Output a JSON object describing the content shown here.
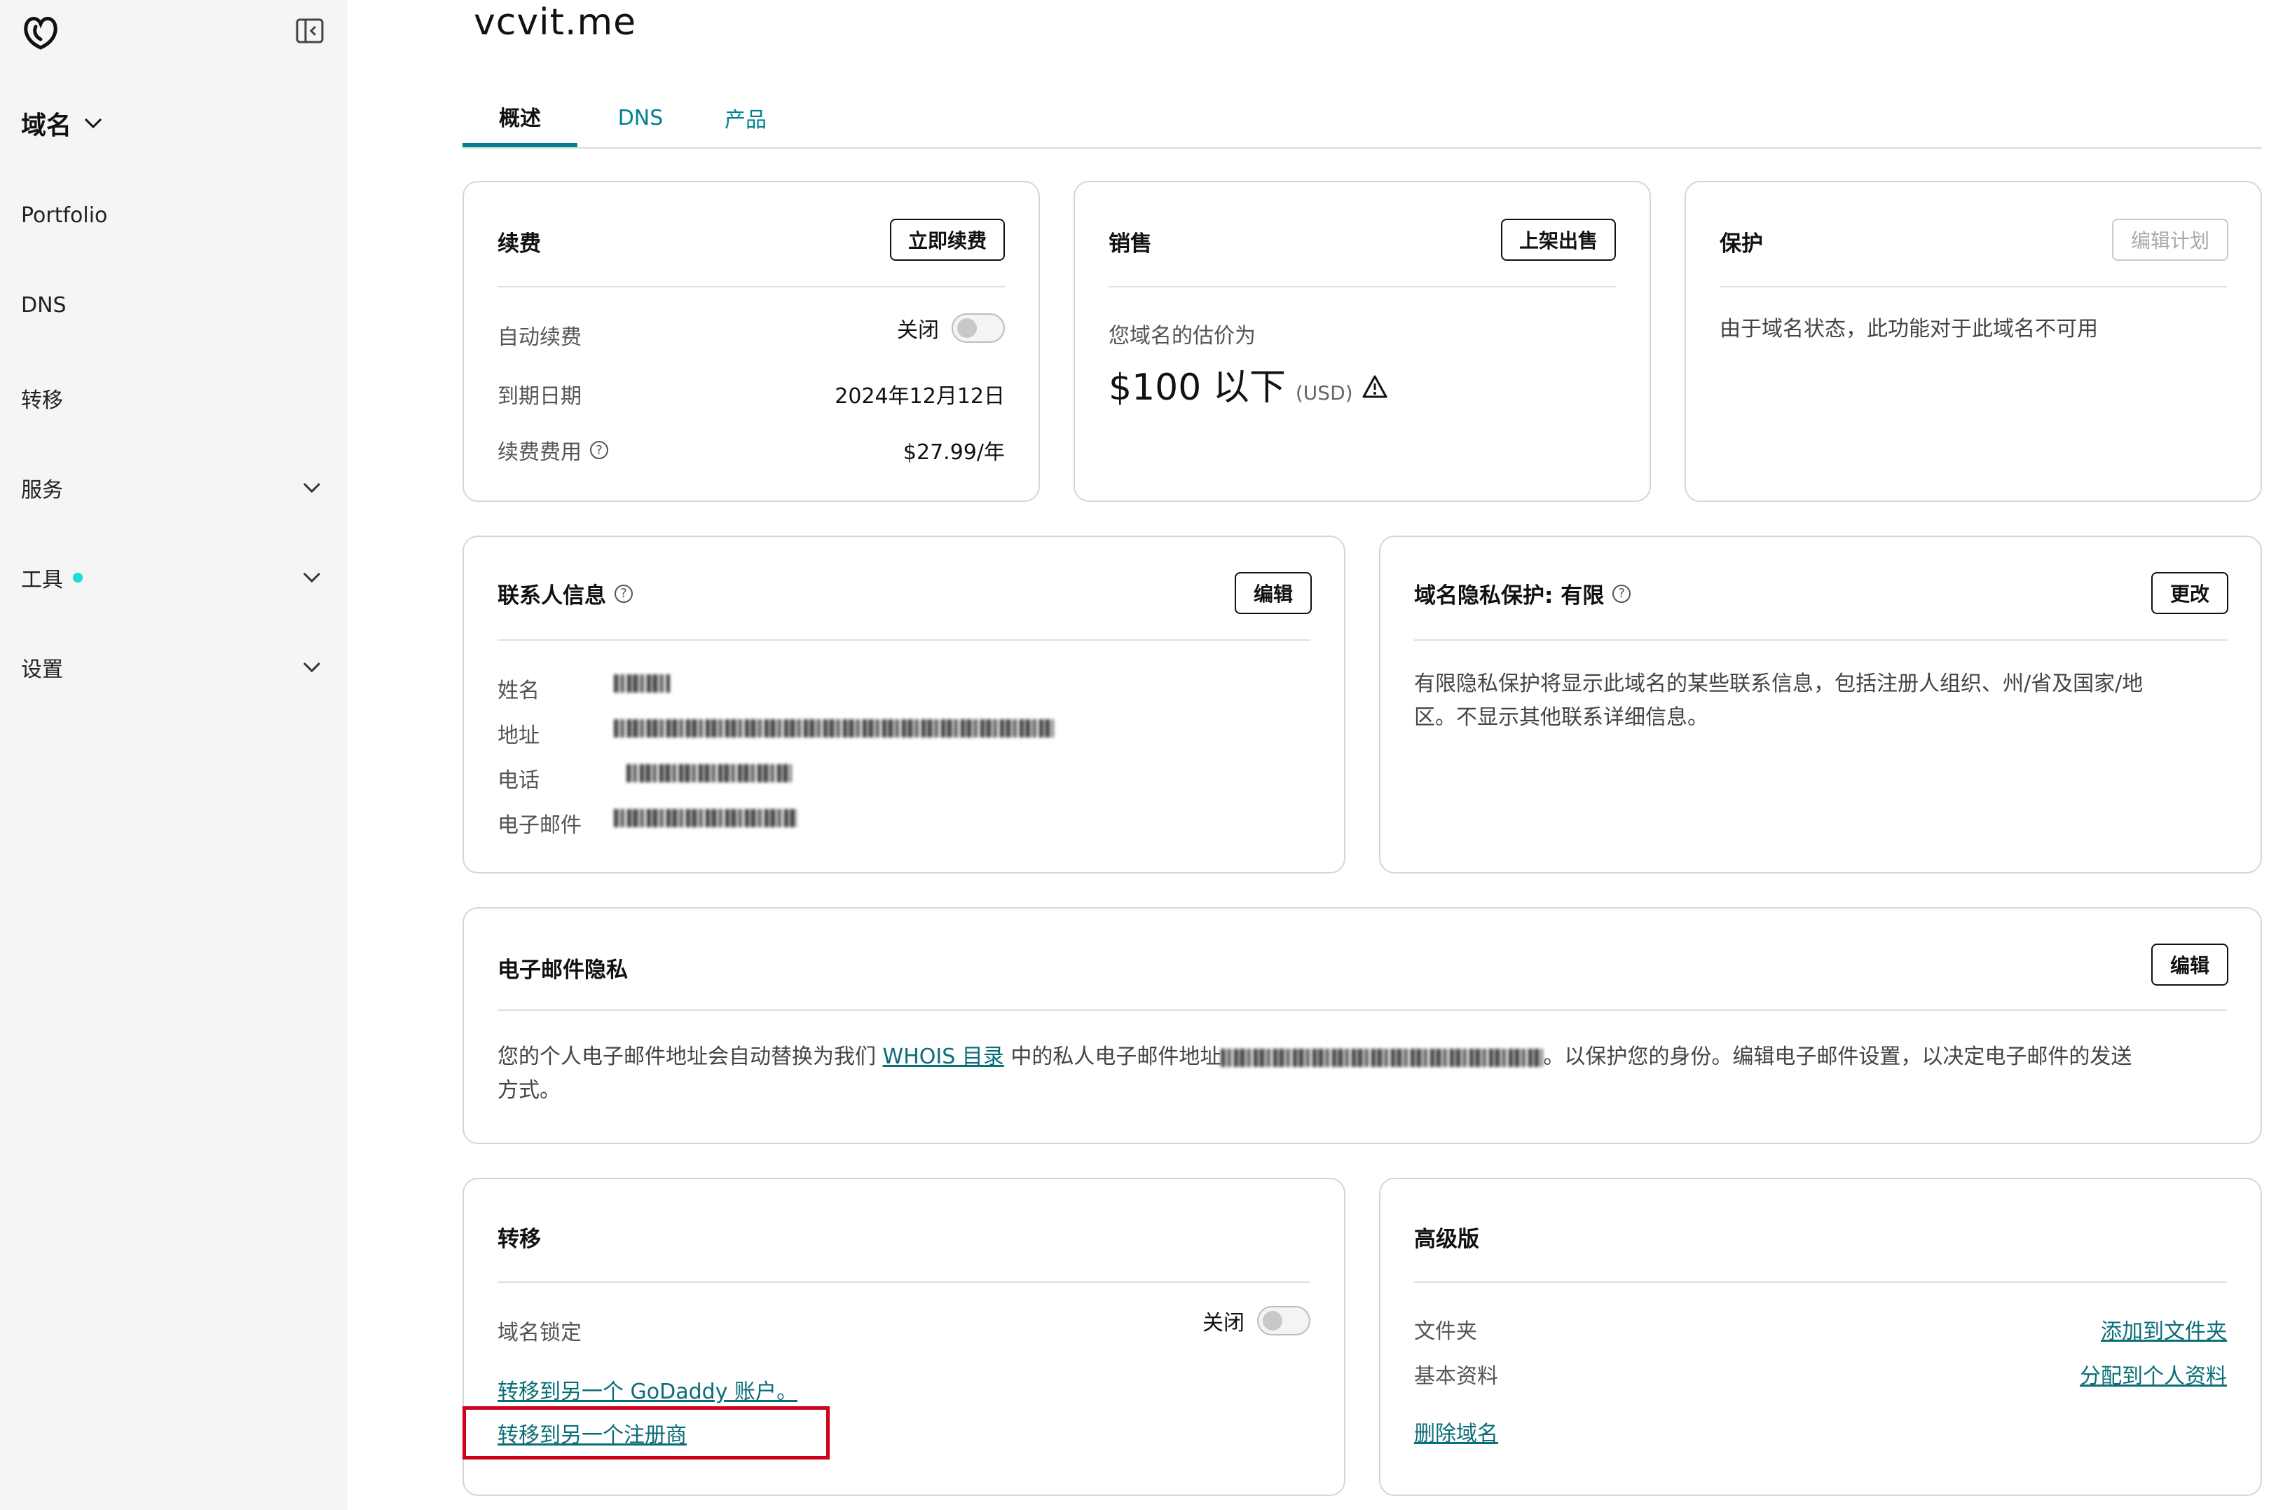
{
  "sidebar": {
    "domain_switch": "域名",
    "items": [
      {
        "label": "Portfolio",
        "has_chevron": false
      },
      {
        "label": "DNS",
        "has_chevron": false
      },
      {
        "label": "转移",
        "has_chevron": false
      },
      {
        "label": "服务",
        "has_chevron": true
      },
      {
        "label": "工具",
        "has_chevron": true,
        "badge_dot": true
      },
      {
        "label": "设置",
        "has_chevron": true
      }
    ]
  },
  "header": {
    "domain": "vcvit.me",
    "tabs": [
      "概述",
      "DNS",
      "产品"
    ],
    "active_tab": "概述"
  },
  "renewal": {
    "title": "续费",
    "button": "立即续费",
    "auto_label": "自动续费",
    "auto_value": "关闭",
    "expiry_label": "到期日期",
    "expiry_value": "2024年12月12日",
    "fee_label": "续费费用",
    "fee_value": "$27.99/年"
  },
  "sale": {
    "title": "销售",
    "button": "上架出售",
    "estimate_label": "您域名的估价为",
    "estimate_value": "$100 以下",
    "currency": "(USD)"
  },
  "protection": {
    "title": "保护",
    "button": "编辑计划",
    "message": "由于域名状态，此功能对于此域名不可用"
  },
  "contact": {
    "title": "联系人信息",
    "button": "编辑",
    "fields": [
      {
        "label": "姓名"
      },
      {
        "label": "地址"
      },
      {
        "label": "电话"
      },
      {
        "label": "电子邮件"
      }
    ]
  },
  "privacy": {
    "title": "域名隐私保护: 有限",
    "button": "更改",
    "message_line1": "有限隐私保护将显示此域名的某些联系信息，包括注册人组织、州/省及国家/地",
    "message_line2": "区。不显示其他联系详细信息。"
  },
  "email_privacy": {
    "title": "电子邮件隐私",
    "button": "编辑",
    "text_before": "您的个人电子邮件地址会自动替换为我们",
    "link": "WHOIS 目录",
    "text_middle": "中的私人电子邮件地址",
    "text_after": "。以保护您的身份。编辑电子邮件设置，以决定电子邮件的发送",
    "text_line2": "方式。"
  },
  "transfer": {
    "title": "转移",
    "lock_label": "域名锁定",
    "lock_value": "关闭",
    "link1": "转移到另一个 GoDaddy 账户。",
    "link2": "转移到另一个注册商"
  },
  "premium": {
    "title": "高级版",
    "folder_label": "文件夹",
    "folder_link": "添加到文件夹",
    "profile_label": "基本资料",
    "profile_link": "分配到个人资料",
    "delete_link": "删除域名"
  },
  "colors": {
    "accent": "#00838f",
    "link": "#0a6d78",
    "highlight": "#d0021b",
    "sidebar_bg": "#f5f5f5",
    "dot": "#1bdbdb"
  }
}
